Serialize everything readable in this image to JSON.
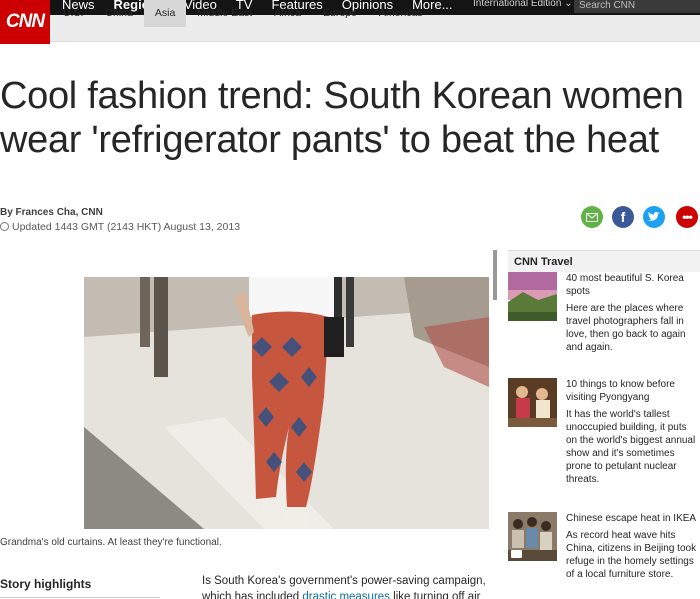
{
  "header": {
    "logo": "CNN",
    "nav": [
      "News",
      "Regions",
      "Video",
      "TV",
      "Features",
      "Opinions",
      "More..."
    ],
    "nav_active": "Regions",
    "edition": "International Edition",
    "search_placeholder": "Search CNN",
    "subnav": [
      "U.S.",
      "China",
      "Asia",
      "Middle East",
      "Africa",
      "Europe",
      "Americas"
    ],
    "subnav_active": "Asia"
  },
  "article": {
    "headline": "Cool fashion trend: South Korean women wear 'refrigerator pants' to beat the heat",
    "byline": "By Frances Cha, CNN",
    "updated": "Updated 1443 GMT (2143 HKT) August 13, 2013",
    "caption": "Grandma's old curtains. At least they're functional.",
    "highlights_label": "Story highlights",
    "body_before": "Is South Korea's government's power-saving campaign, which has included ",
    "body_link": "drastic measures",
    "body_after": " like turning off air"
  },
  "share": {
    "email_color": "#5fb346",
    "facebook_color": "#3b5998",
    "twitter_color": "#1da1f2",
    "more_color": "#cc0000"
  },
  "sidebar": {
    "heading": "CNN Travel",
    "items": [
      {
        "title": "40 most beautiful S. Korea spots",
        "desc": "Here are the places where travel photographers fall in love, then go back to again and again."
      },
      {
        "title": "10 things to know before visiting Pyongyang",
        "desc": "It has the world's tallest unoccupied building, it puts on the world's biggest annual show and it's sometimes prone to petulant nuclear threats."
      },
      {
        "title": "Chinese escape heat in IKEA",
        "desc": "As record heat wave hits China, citizens in Beijing took refuge in the homely settings of a local furniture store."
      }
    ]
  }
}
